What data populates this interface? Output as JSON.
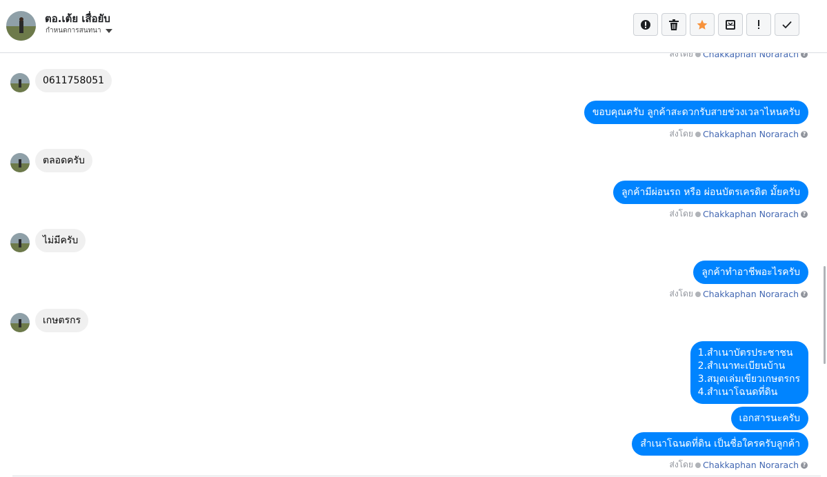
{
  "header": {
    "name": "ตอ.เต้ย เสื่อยับ",
    "subtitle": "กำหนดการสนทนา",
    "actions": [
      "alert-icon",
      "trash-icon",
      "star-icon",
      "inbox-icon",
      "exclamation-icon",
      "check-icon"
    ],
    "star_color": "#f7923b"
  },
  "sent_by": {
    "label": "ส่งโดย",
    "agent": "Chakkaphan Norarach"
  },
  "messages": [
    {
      "from": "customer",
      "text": "0611758051"
    },
    {
      "from": "page",
      "text": "ขอบคุณครับ ลูกค้าสะดวกรับสายช่วงเวลาไหนครับ"
    },
    {
      "from": "customer",
      "text": "ตลอดครับ"
    },
    {
      "from": "page",
      "text": "ลูกค้ามีผ่อนรถ หรือ ผ่อนบัตรเครดิต มั้ยครับ"
    },
    {
      "from": "customer",
      "text": "ไม่มีครับ"
    },
    {
      "from": "page",
      "text": "ลูกค้าทำอาชีพอะไรครับ"
    },
    {
      "from": "customer",
      "text": "เกษตรกร"
    },
    {
      "from": "page",
      "text": "1.สำเนาบัตรประชาชน\n2.สำเนาทะเบียนบ้าน\n3.สมุดเล่มเขียวเกษตรกร\n4.สำเนาโฉนดที่ดิน"
    },
    {
      "from": "page",
      "text": "เอกสารนะครับ"
    },
    {
      "from": "page",
      "text": "สำเนาโฉนดที่ดิน เป็นชื่อใครครับลูกค้า"
    }
  ],
  "colors": {
    "outgoing_bubble": "#0084ff",
    "incoming_bubble": "#f0f0f0",
    "agent_link": "#4267b2"
  }
}
